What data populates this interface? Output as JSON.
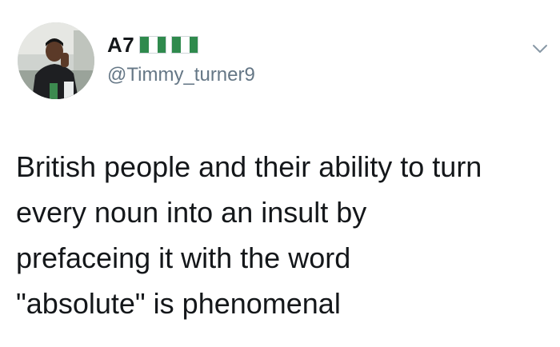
{
  "author": {
    "display_name": "A7",
    "handle": "@Timmy_turner9",
    "flag_emoji_count": 2
  },
  "tweet": {
    "lines": [
      "British people and their ability to turn",
      "every noun into an insult by",
      "prefaceing it with the word",
      "\"absolute\" is phenomenal"
    ]
  },
  "icons": {
    "more": "chevron-down-icon",
    "flag": "nigeria-flag-icon",
    "avatar": "avatar"
  },
  "colors": {
    "text": "#14171a",
    "secondary_text": "#657786",
    "flag_green": "#2f8a4d",
    "background": "#ffffff"
  }
}
